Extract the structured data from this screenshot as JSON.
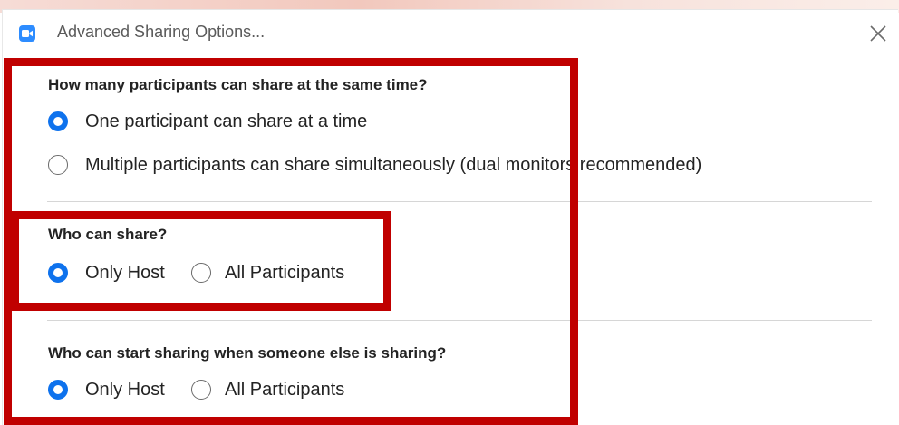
{
  "window": {
    "title": "Advanced Sharing Options...",
    "accent_color": "#2d8cff",
    "icons": {
      "app": "zoom-video-icon",
      "close": "close-icon"
    }
  },
  "sections": [
    {
      "heading": "How many participants can share at the same time?",
      "options": [
        {
          "label": "One participant can share at a time",
          "selected": true
        },
        {
          "label": "Multiple participants can share simultaneously (dual monitors recommended)",
          "selected": false
        }
      ]
    },
    {
      "heading": "Who can share?",
      "options": [
        {
          "label": "Only Host",
          "selected": true
        },
        {
          "label": "All Participants",
          "selected": false
        }
      ]
    },
    {
      "heading": "Who can start sharing when someone else is sharing?",
      "options": [
        {
          "label": "Only Host",
          "selected": true
        },
        {
          "label": "All Participants",
          "selected": false
        }
      ]
    }
  ],
  "annotation": {
    "highlight_color": "#c00000"
  }
}
